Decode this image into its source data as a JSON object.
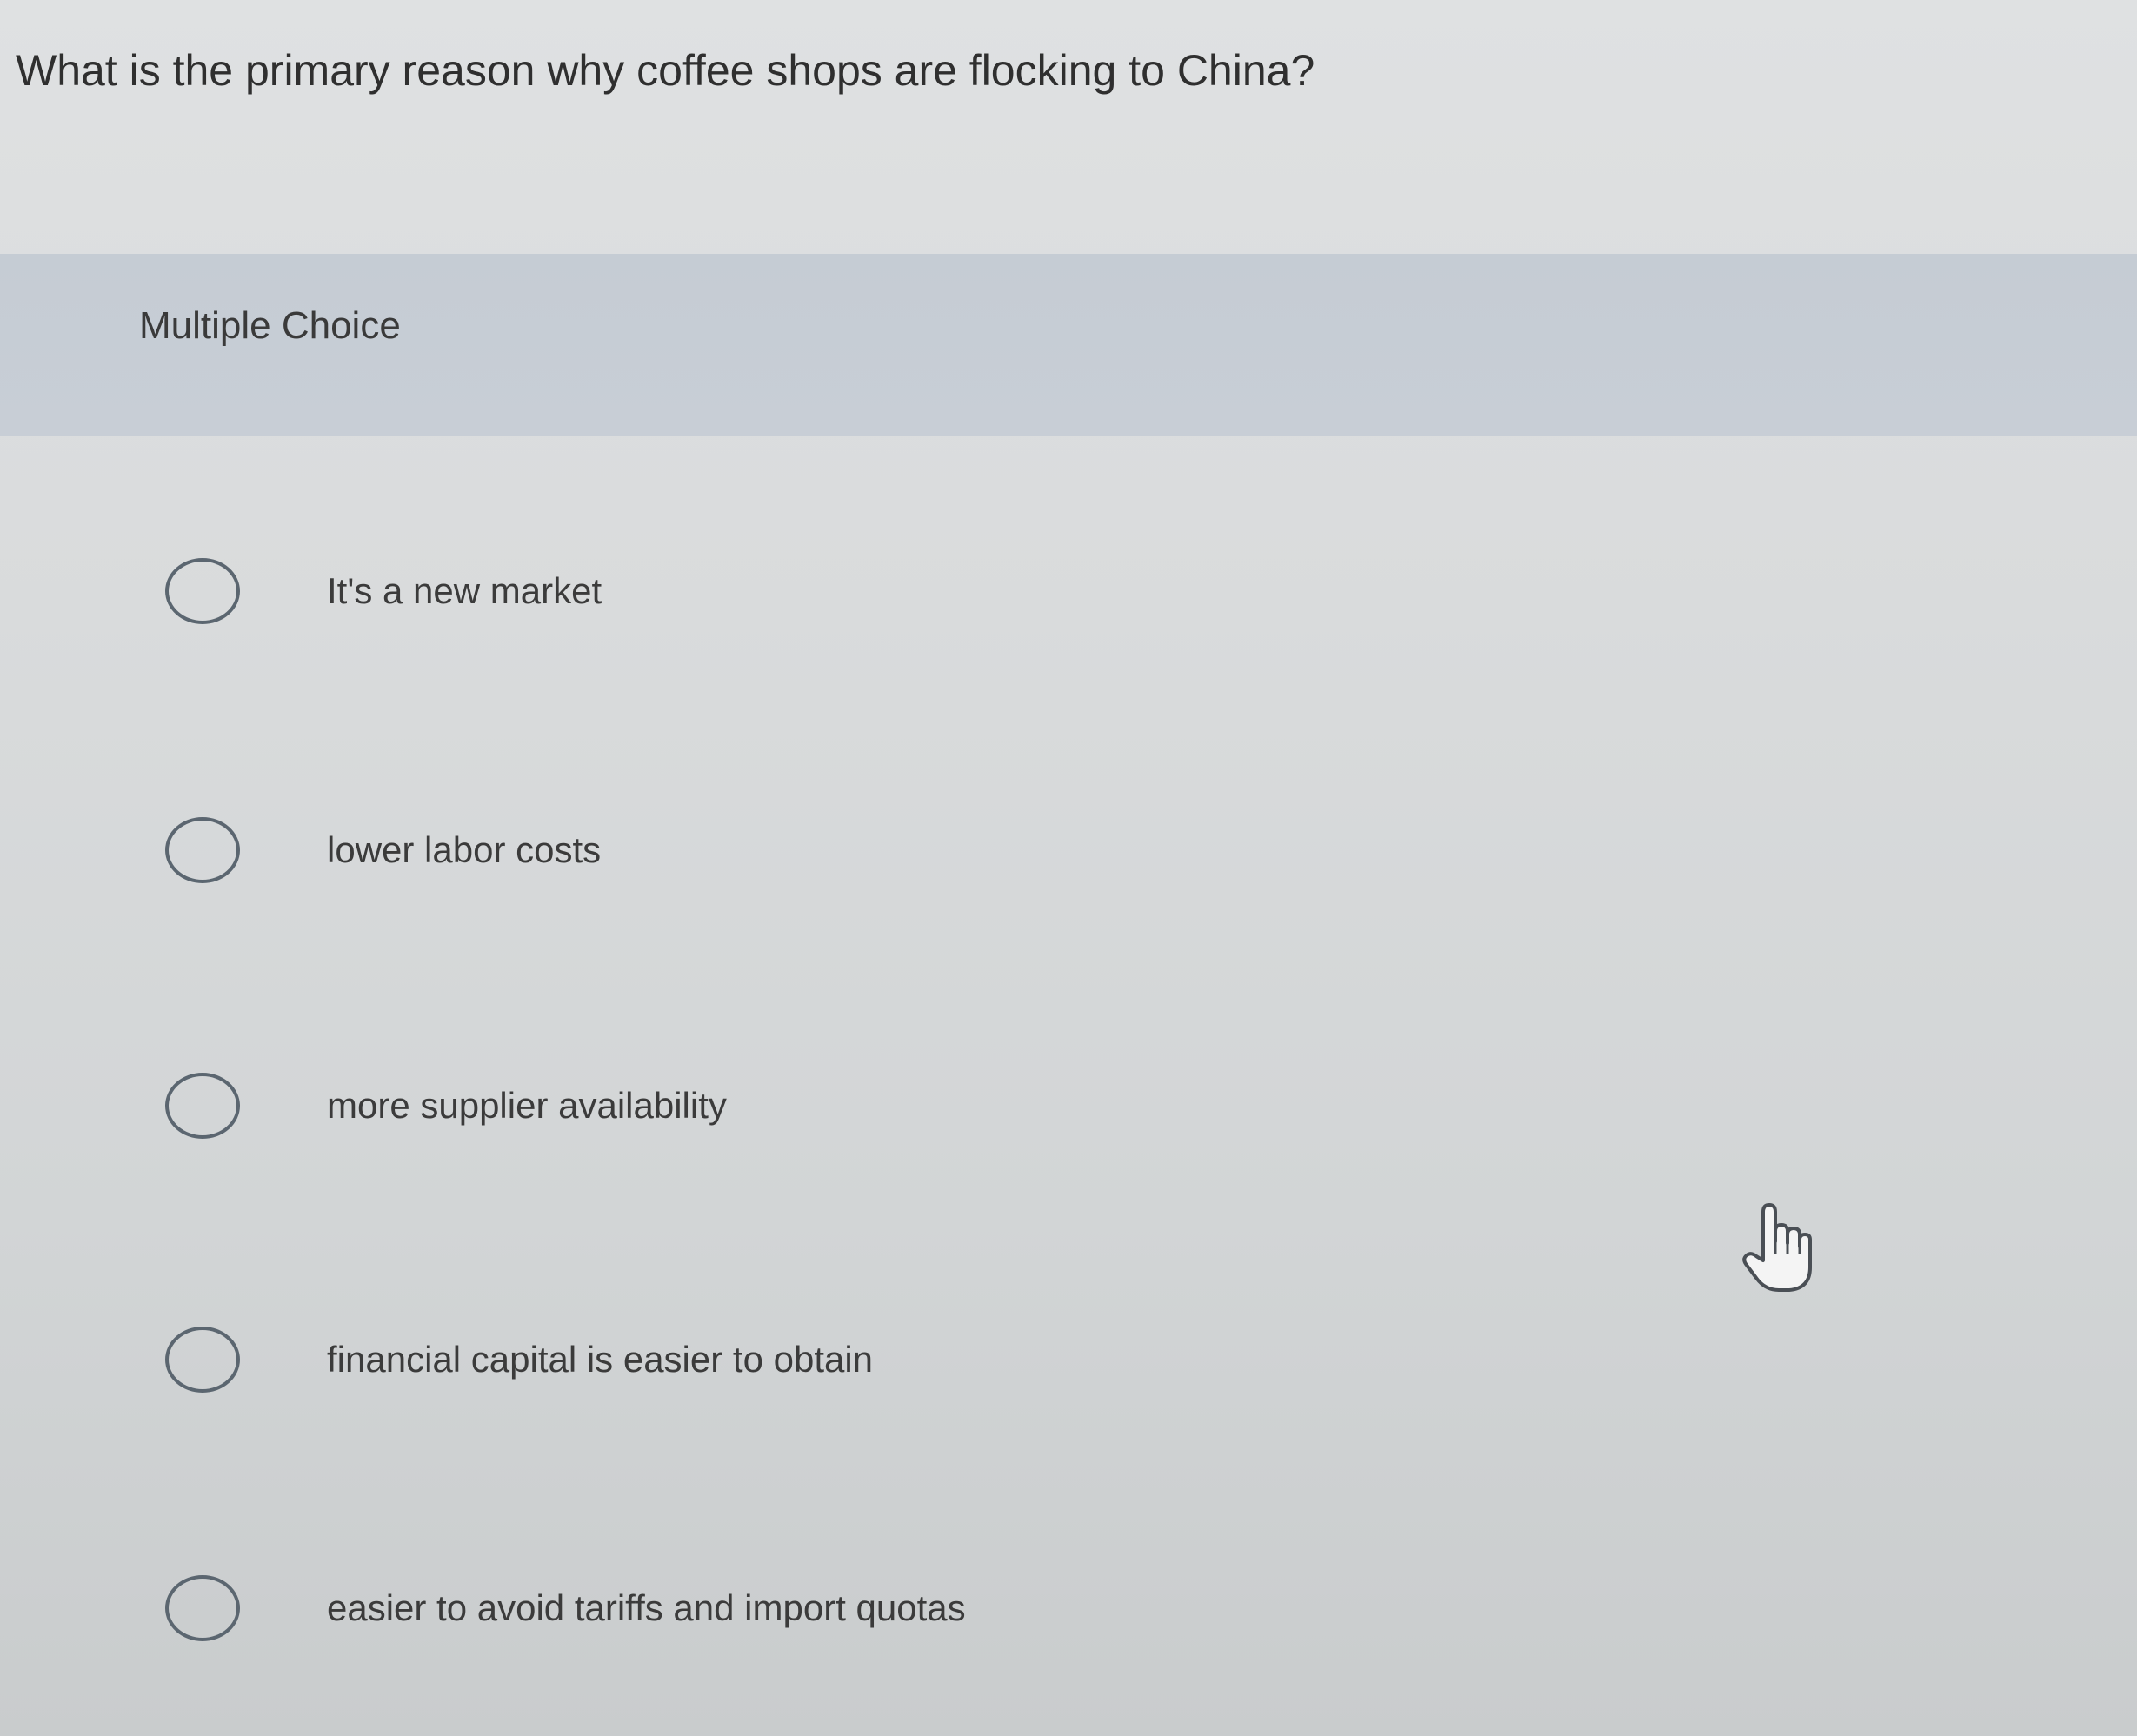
{
  "question": {
    "text": "What is the primary reason why coffee shops are flocking to China?"
  },
  "section": {
    "label": "Multiple Choice"
  },
  "options": [
    {
      "label": "It's a new market"
    },
    {
      "label": "lower labor costs"
    },
    {
      "label": "more supplier availability"
    },
    {
      "label": "financial capital is easier to obtain"
    },
    {
      "label": "easier to avoid tariffs and import quotas"
    }
  ],
  "cursor": {
    "icon": "hand-pointer-icon"
  }
}
